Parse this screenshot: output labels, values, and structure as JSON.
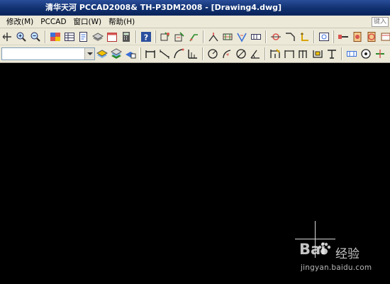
{
  "window": {
    "title": "清华天河 PCCAD2008& TH-P3DM2008 - [Drawing4.dwg]"
  },
  "menu": {
    "items": [
      "修改(M)",
      "PCCAD",
      "窗口(W)",
      "帮助(H)"
    ],
    "help_search_placeholder": "键入"
  },
  "toolbar1": {
    "icons": [
      "zoom-pan-icon",
      "zoom-in-icon",
      "zoom-out-icon",
      "gradient-icon",
      "table-icon",
      "document-icon",
      "stack-icon",
      "calendar-icon",
      "calculator-icon",
      "help-icon",
      "dim-grid-icon",
      "dim-tag-icon",
      "leader-icon",
      "leader-arrow-icon",
      "symbol-weld-icon",
      "symbol-check-icon",
      "symbol-datum-icon",
      "tolerance-icon",
      "angle-icon",
      "corner-icon",
      "image-icon",
      "bolt-icon",
      "part-list-icon",
      "bearing-icon",
      "box-icon"
    ]
  },
  "toolbar2": {
    "layer_value": "",
    "icons": [
      "layer-state-icon",
      "layer-stack-icon",
      "layer-props-icon",
      "linear-dim-icon",
      "aligned-dim-icon",
      "arc-dim-icon",
      "ordinate-dim-icon",
      "radius-dim-icon",
      "jog-dim-icon",
      "diameter-dim-icon",
      "angular-dim-icon",
      "baseline-dim-icon",
      "continue-dim-icon",
      "chain-dim-icon",
      "quick-dim-icon",
      "center-mark-icon",
      "dim-edit-icon",
      "dim-text-icon",
      "dim-update-icon"
    ]
  },
  "watermark": {
    "logo": "Bai",
    "cn": "经验",
    "url": "jingyan.baidu.com"
  },
  "colors": {
    "titlebar": "#10306f",
    "menubar": "#ece9d8",
    "canvas": "#000000"
  }
}
